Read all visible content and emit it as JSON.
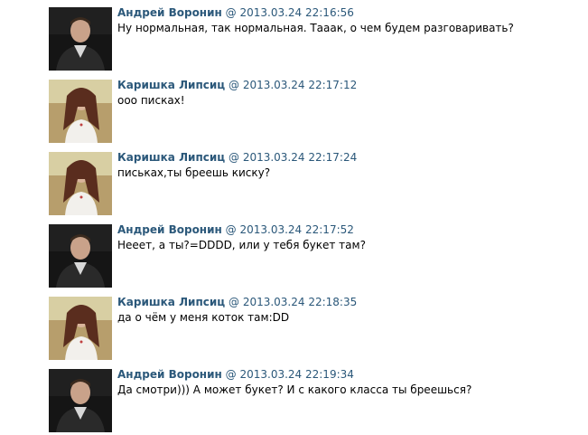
{
  "messages": [
    {
      "author": "Андрей Воронин",
      "at": "@",
      "date": "2013.03.24 22:16:56",
      "text": "Ну нормальная, так нормальная. Тааак, о чем будем разговаривать?",
      "avatar": "andrey-avatar"
    },
    {
      "author": "Каришка Липсиц",
      "at": "@",
      "date": "2013.03.24 22:17:12",
      "text": "ооо писках!",
      "avatar": "karishka-avatar"
    },
    {
      "author": "Каришка Липсиц",
      "at": "@",
      "date": "2013.03.24 22:17:24",
      "text": "письках,ты бреешь киску?",
      "avatar": "karishka-avatar"
    },
    {
      "author": "Андрей Воронин",
      "at": "@",
      "date": "2013.03.24 22:17:52",
      "text": "Нееет, а ты?=DDDD, или у тебя букет там?",
      "avatar": "andrey-avatar"
    },
    {
      "author": "Каришка Липсиц",
      "at": "@",
      "date": "2013.03.24 22:18:35",
      "text": "да о чём у меня коток там:DD",
      "avatar": "karishka-avatar"
    },
    {
      "author": "Андрей Воронин",
      "at": "@",
      "date": "2013.03.24 22:19:34",
      "text": "Да смотри))) А может букет? И с какого класса ты бреешься?",
      "avatar": "andrey-avatar"
    }
  ],
  "colors": {
    "author": "#2b587a",
    "date": "#2b587a",
    "text": "#000000"
  }
}
